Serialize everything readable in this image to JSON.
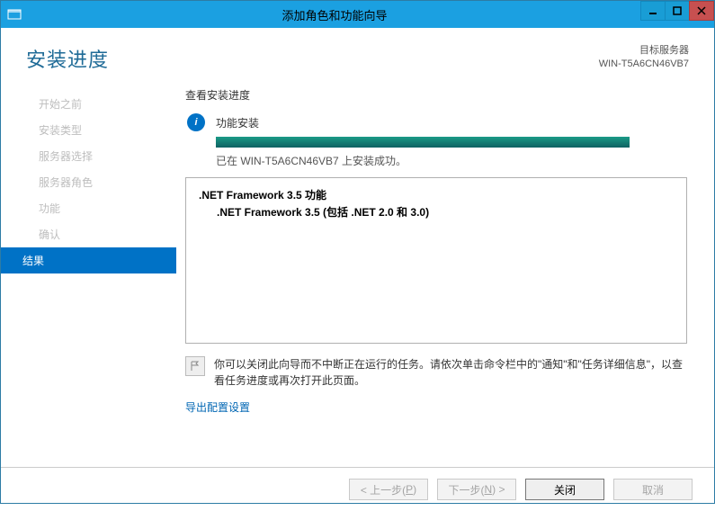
{
  "titlebar": {
    "title": "添加角色和功能向导"
  },
  "header": {
    "page_title": "安装进度",
    "target_label": "目标服务器",
    "target_value": "WIN-T5A6CN46VB7"
  },
  "sidebar": {
    "items": [
      {
        "label": "开始之前"
      },
      {
        "label": "安装类型"
      },
      {
        "label": "服务器选择"
      },
      {
        "label": "服务器角色"
      },
      {
        "label": "功能"
      },
      {
        "label": "确认"
      },
      {
        "label": "结果",
        "active": true
      }
    ]
  },
  "main": {
    "section_title": "查看安装进度",
    "status_label": "功能安装",
    "progress_msg": "已在 WIN-T5A6CN46VB7 上安装成功。",
    "feature_parent": ".NET Framework 3.5 功能",
    "feature_child": ".NET Framework 3.5 (包括 .NET 2.0 和 3.0)",
    "note_text": "你可以关闭此向导而不中断正在运行的任务。请依次单击命令栏中的\"通知\"和\"任务详细信息\"，以查看任务进度或再次打开此页面。",
    "export_link": "导出配置设置"
  },
  "footer": {
    "prev_prefix": "< 上一步(",
    "prev_accel": "P",
    "prev_suffix": ")",
    "next_prefix": "下一步(",
    "next_accel": "N",
    "next_suffix": ") >",
    "close": "关闭",
    "cancel": "取消"
  }
}
